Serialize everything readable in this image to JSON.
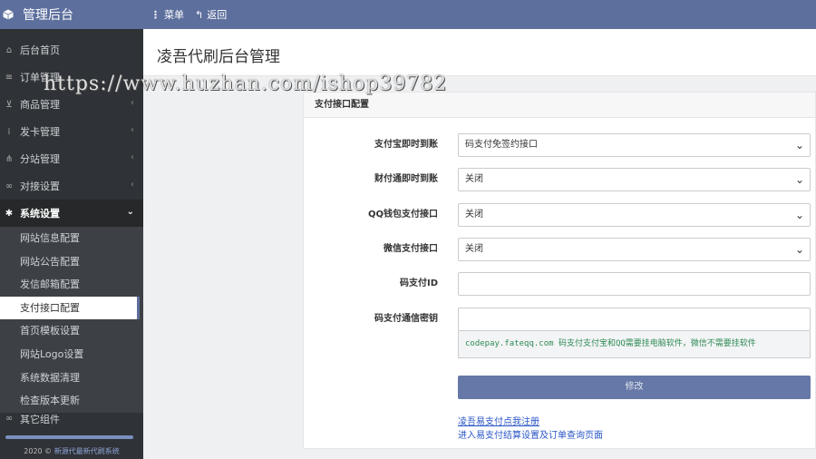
{
  "brand": {
    "title": "管理后台"
  },
  "topnav": {
    "menu": "菜单",
    "back": "返回"
  },
  "sidebar": {
    "items": [
      {
        "icon": "home-icon",
        "glyph": "⌂",
        "label": "后台首页"
      },
      {
        "icon": "list-icon",
        "glyph": "≡",
        "label": "订单管理"
      },
      {
        "icon": "cart-icon",
        "glyph": "⊻",
        "label": "商品管理",
        "arrow": "‹"
      },
      {
        "icon": "grid-icon",
        "glyph": "⁞",
        "label": "发卡管理",
        "arrow": "‹"
      },
      {
        "icon": "sitemap-icon",
        "glyph": "⋔",
        "label": "分站管理",
        "arrow": "‹"
      },
      {
        "icon": "link-icon",
        "glyph": "∞",
        "label": "对接设置",
        "arrow": "‹"
      },
      {
        "icon": "gear-icon",
        "glyph": "✱",
        "label": "系统设置",
        "arrow": "⌄"
      }
    ],
    "subitems": [
      "网站信息配置",
      "网站公告配置",
      "发信邮箱配置",
      "支付接口配置",
      "首页模板设置",
      "网站Logo设置",
      "系统数据清理",
      "检查版本更新"
    ],
    "partial_item": "其它组件",
    "footer_year": "2020 ©",
    "footer_link": "新源代最新代刷系统"
  },
  "page": {
    "title": "凌吾代刷后台管理"
  },
  "panel": {
    "heading": "支付接口配置",
    "fields": [
      {
        "label": "支付宝即时到账",
        "value": "码支付免签约接口"
      },
      {
        "label": "财付通即时到账",
        "value": "关闭"
      },
      {
        "label": "QQ钱包支付接口",
        "value": "关闭"
      },
      {
        "label": "微信支付接口",
        "value": "关闭"
      },
      {
        "label": "码支付ID",
        "value": ""
      },
      {
        "label": "码支付通信密钥",
        "value": ""
      }
    ],
    "hint": "codepay.fateqq.com 码支付支付宝和QQ需要挂电脑软件，微信不需要挂软件",
    "submit": "修改",
    "link1": "凌吾易支付点我注册",
    "link2": "进入易支付结算设置及订单查询页面"
  },
  "watermark": "https://www.huzhan.com/ishop39782"
}
